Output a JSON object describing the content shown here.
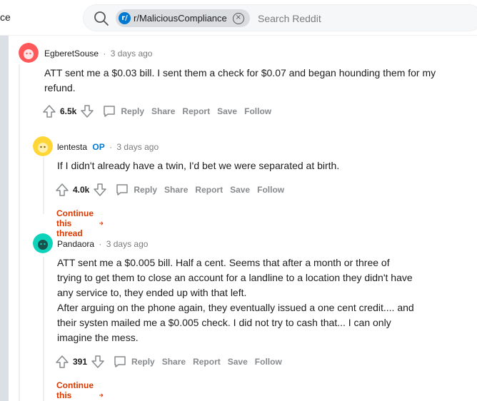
{
  "header": {
    "partial_title": "ce",
    "search": {
      "community_chip": "r/MaliciousCompliance",
      "chip_initial": "r/",
      "placeholder": "Search Reddit"
    }
  },
  "comments": [
    {
      "username": "EgberetSouse",
      "op_badge": "",
      "separator": "·",
      "time": "3 days ago",
      "body": [
        "ATT sent me a $0.03 bill. I sent them a check for $0.07 and began hounding them for my refund."
      ],
      "score": "6.5k",
      "avatar_color": "#ff585b",
      "actions": [
        "Reply",
        "Share",
        "Report",
        "Save",
        "Follow"
      ],
      "continue_thread": ""
    },
    {
      "username": "lentesta",
      "op_badge": "OP",
      "separator": "·",
      "time": "3 days ago",
      "body": [
        "If I didn't already have a twin, I'd bet we were separated at birth."
      ],
      "score": "4.0k",
      "avatar_color": "#ffd635",
      "actions": [
        "Reply",
        "Share",
        "Report",
        "Save",
        "Follow"
      ],
      "continue_thread": "Continue this thread"
    },
    {
      "username": "Pandaora",
      "op_badge": "",
      "separator": "·",
      "time": "3 days ago",
      "body": [
        "ATT sent me a $0.005 bill. Half a cent. Seems that after a month or three of trying to get them to close an account for a landline to a location they didn't have any service to, they ended up with that left.",
        "After arguing on the phone again, they eventually issued a one cent credit.... and their systen mailed me a $0.005 check. I did not try to cash that... I can only imagine the mess."
      ],
      "score": "391",
      "avatar_color": "#0dd3bb",
      "actions": [
        "Reply",
        "Share",
        "Report",
        "Save",
        "Follow"
      ],
      "continue_thread": "Continue this thread"
    }
  ],
  "colors": {
    "op": "#0079d3",
    "continue": "#d93a00",
    "muted": "#878a8c"
  }
}
